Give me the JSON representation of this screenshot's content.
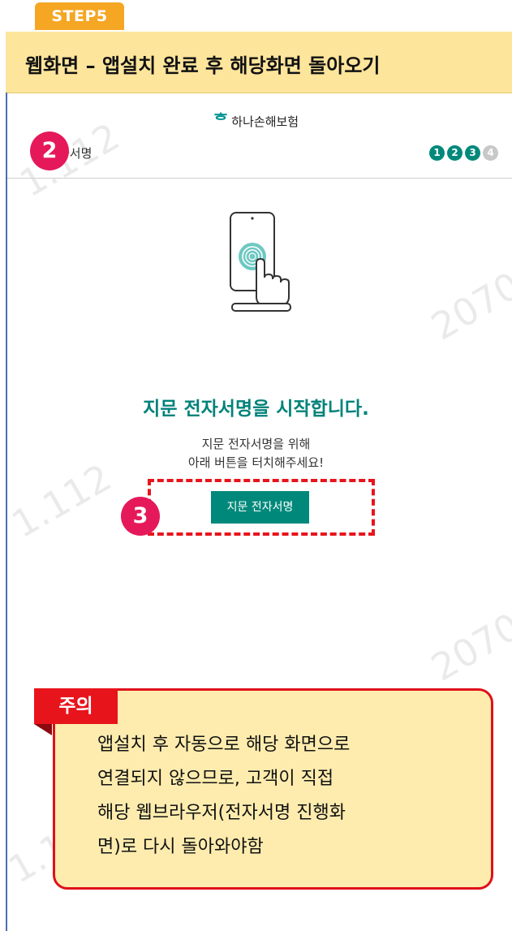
{
  "step": {
    "label": "STEP5"
  },
  "title": "웹화면 – 앱설치 완료 후 해당화면 돌아오기",
  "app": {
    "logo_mark": "ᄒ",
    "logo_text": "하나손해보험",
    "header_label": "자서명",
    "steps": [
      "1",
      "2",
      "3",
      "4"
    ],
    "active_steps": 3
  },
  "badges": {
    "b2": "2",
    "b3": "3"
  },
  "content": {
    "heading": "지문 전자서명을 시작합니다.",
    "desc_line1": "지문 전자서명을 위해",
    "desc_line2": "아래 버튼을 터치해주세요!",
    "button_label": "지문 전자서명"
  },
  "notice": {
    "tag": "주의",
    "lines": [
      "앱설치 후 자동으로 해당 화면으로",
      "연결되지 않으므로, 고객이 직접",
      "해당 웹브라우저(전자서명 진행화",
      "면)로 다시 돌아와야함"
    ]
  },
  "watermarks": [
    "1.112",
    "2070",
    "1.112",
    "2070",
    "1.1"
  ],
  "colors": {
    "accent": "#00897b",
    "highlight": "#e8141c",
    "badge": "#e5195a",
    "step_tab": "#f5a623",
    "title_bg": "#fde59c"
  }
}
